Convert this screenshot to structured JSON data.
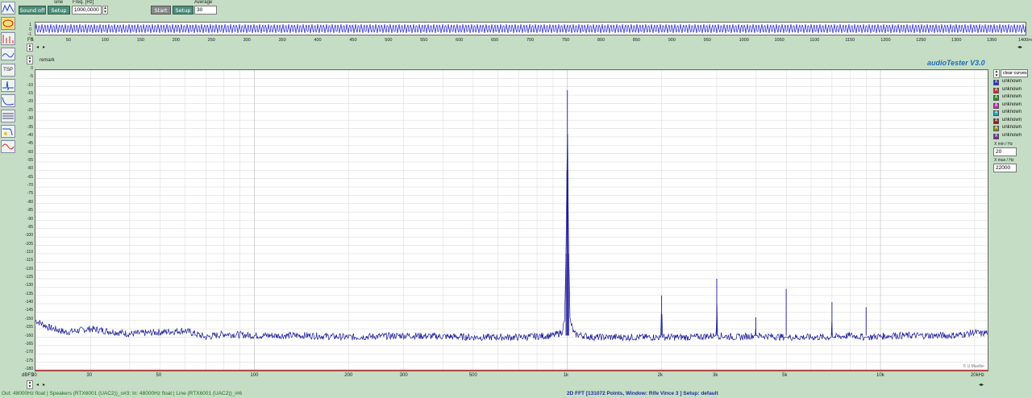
{
  "toolbar": {
    "sound_button": "Sound off",
    "setup_button": "Setup",
    "waveform_label": "sine",
    "freq_label": "Freq. [Hz]",
    "freq_value": "1000,0000",
    "start_button": "Start",
    "setup2_button": "Setup",
    "average_label": "Average",
    "average_value": "30"
  },
  "scope": {
    "y_ticks": [
      "1",
      "0",
      "-1"
    ],
    "x_ticks": [
      "0",
      "50",
      "100",
      "150",
      "200",
      "250",
      "300",
      "350",
      "400",
      "450",
      "500",
      "550",
      "600",
      "650",
      "700",
      "750",
      "800",
      "850",
      "900",
      "950",
      "1000",
      "1050",
      "1100",
      "1150",
      "1200",
      "1250",
      "1300",
      "1350",
      "1400ms"
    ],
    "fs_label": "FS"
  },
  "remark_label": "remark",
  "brand": "audioTester  V3.0",
  "copyright": "© U.Mueller",
  "legend": {
    "clear_label": "clear curves",
    "items": [
      {
        "letter": "A",
        "label": "unknown",
        "color": "#1a2fd6"
      },
      {
        "letter": "A",
        "label": "unknown",
        "color": "#e02020"
      },
      {
        "letter": "A",
        "label": "unknown",
        "color": "#2a8a2a"
      },
      {
        "letter": "A",
        "label": "unknown",
        "color": "#d020c0"
      },
      {
        "letter": "A",
        "label": "unknown",
        "color": "#20a0c0"
      },
      {
        "letter": "A",
        "label": "unknown",
        "color": "#8a1a1a"
      },
      {
        "letter": "A",
        "label": "unknown",
        "color": "#8a8a20"
      },
      {
        "letter": "A",
        "label": "unknown",
        "color": "#7a20a0"
      }
    ],
    "xmin_label": "X min / Hz",
    "xmin_value": "20",
    "xmax_label": "X max / Hz",
    "xmax_value": "22000"
  },
  "status": {
    "left": "Out: 48000Hz float  | Speakers (RTX6001 (UAC2))_o#3;  In: 48000Hz float  | Line (RTX6001 (UAC2))_i#6",
    "center": "2D FFT [131072 Points, Window: Rife Vince 3 ]  Setup:  default"
  },
  "chart_data": {
    "type": "line",
    "xscale": "log",
    "xlim": [
      20,
      22000
    ],
    "ylim": [
      -180,
      0
    ],
    "grid": true,
    "x_ticks": [
      {
        "v": 20,
        "t": "20"
      },
      {
        "v": 30,
        "t": "30"
      },
      {
        "v": 50,
        "t": "50"
      },
      {
        "v": 100,
        "t": "100"
      },
      {
        "v": 200,
        "t": "200"
      },
      {
        "v": 300,
        "t": "300"
      },
      {
        "v": 500,
        "t": "500"
      },
      {
        "v": 1000,
        "t": "1k"
      },
      {
        "v": 2000,
        "t": "2k"
      },
      {
        "v": 3000,
        "t": "3k"
      },
      {
        "v": 5000,
        "t": "5k"
      },
      {
        "v": 10000,
        "t": "10k"
      },
      {
        "v": 20000,
        "t": "20kHz"
      }
    ],
    "y_ticks": [
      "0",
      "-5",
      "-10",
      "-15",
      "-20",
      "-25",
      "-30",
      "-35",
      "-40",
      "-45",
      "-50",
      "-55",
      "-60",
      "-65",
      "-70",
      "-75",
      "-80",
      "-85",
      "-90",
      "-95",
      "-100",
      "-105",
      "-110",
      "-115",
      "-120",
      "-125",
      "-130",
      "-135",
      "-140",
      "-145",
      "-150",
      "-155",
      "-160",
      "-165",
      "-170",
      "-175",
      "-180"
    ],
    "y_unit": "dBFS",
    "noise_floor": -159,
    "series": [
      {
        "color": "#1a1a9a",
        "points": [
          [
            20,
            -150
          ],
          [
            22,
            -154
          ],
          [
            25,
            -157
          ],
          [
            30,
            -155
          ],
          [
            40,
            -158
          ],
          [
            50,
            -157
          ],
          [
            60,
            -156
          ],
          [
            70,
            -160
          ],
          [
            80,
            -158
          ],
          [
            100,
            -159
          ],
          [
            150,
            -159
          ],
          [
            200,
            -160
          ],
          [
            300,
            -159
          ],
          [
            500,
            -160
          ],
          [
            700,
            -160
          ],
          [
            900,
            -159
          ],
          [
            960,
            -157
          ],
          [
            980,
            -150
          ],
          [
            990,
            -110
          ],
          [
            997,
            -60
          ],
          [
            1000,
            -12
          ],
          [
            1003,
            -60
          ],
          [
            1010,
            -110
          ],
          [
            1020,
            -150
          ],
          [
            1050,
            -158
          ],
          [
            1200,
            -160
          ],
          [
            1500,
            -160
          ],
          [
            1990,
            -160
          ],
          [
            2000,
            -135
          ],
          [
            2010,
            -160
          ],
          [
            2500,
            -160
          ],
          [
            2990,
            -159
          ],
          [
            3000,
            -125
          ],
          [
            3010,
            -159
          ],
          [
            3500,
            -160
          ],
          [
            3990,
            -159
          ],
          [
            4000,
            -148
          ],
          [
            4010,
            -159
          ],
          [
            4990,
            -160
          ],
          [
            5000,
            -131
          ],
          [
            5010,
            -160
          ],
          [
            5990,
            -160
          ],
          [
            6000,
            -157
          ],
          [
            6010,
            -160
          ],
          [
            6990,
            -160
          ],
          [
            7000,
            -139
          ],
          [
            7010,
            -160
          ],
          [
            7990,
            -159
          ],
          [
            8000,
            -156
          ],
          [
            8010,
            -159
          ],
          [
            8990,
            -160
          ],
          [
            9000,
            -142
          ],
          [
            9010,
            -160
          ],
          [
            11000,
            -159
          ],
          [
            11010,
            -156
          ],
          [
            11020,
            -159
          ],
          [
            14000,
            -159
          ],
          [
            17000,
            -159
          ],
          [
            19000,
            -158
          ],
          [
            20000,
            -157
          ],
          [
            21000,
            -158
          ],
          [
            22000,
            -157
          ]
        ]
      },
      {
        "color": "#e02020",
        "points": [
          [
            20,
            -180
          ],
          [
            22000,
            -180
          ]
        ]
      }
    ]
  }
}
